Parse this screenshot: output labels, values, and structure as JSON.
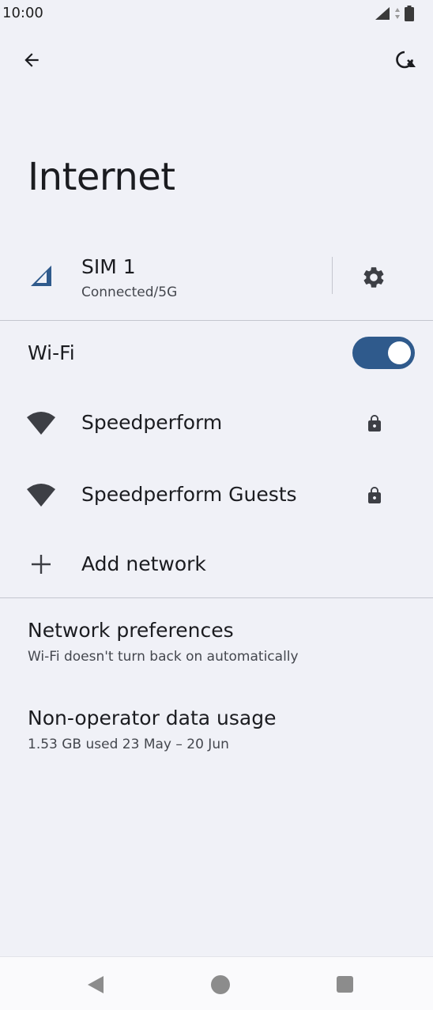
{
  "status_bar": {
    "time": "10:00"
  },
  "app_bar": {
    "back_icon": "arrow-back-icon",
    "refresh_icon": "network-reset-icon"
  },
  "title": "Internet",
  "sim": {
    "name": "SIM 1",
    "status": "Connected/5G",
    "icon": "cellular-signal-icon",
    "settings_icon": "gear-icon"
  },
  "wifi": {
    "label": "Wi-Fi",
    "enabled": true,
    "networks": [
      {
        "name": "Speedperform",
        "secured": true
      },
      {
        "name": "Speedperform Guests",
        "secured": true
      }
    ],
    "add_label": "Add network"
  },
  "preferences": [
    {
      "title": "Network preferences",
      "subtitle": "Wi-Fi doesn't turn back on automatically"
    },
    {
      "title": "Non-operator data usage",
      "subtitle": "1.53 GB used 23 May – 20 Jun"
    }
  ],
  "colors": {
    "background": "#f0f1f7",
    "accent": "#2f5a8c",
    "text": "#1b1c20",
    "secondary_text": "#44474e",
    "divider": "#c4c6cf"
  }
}
